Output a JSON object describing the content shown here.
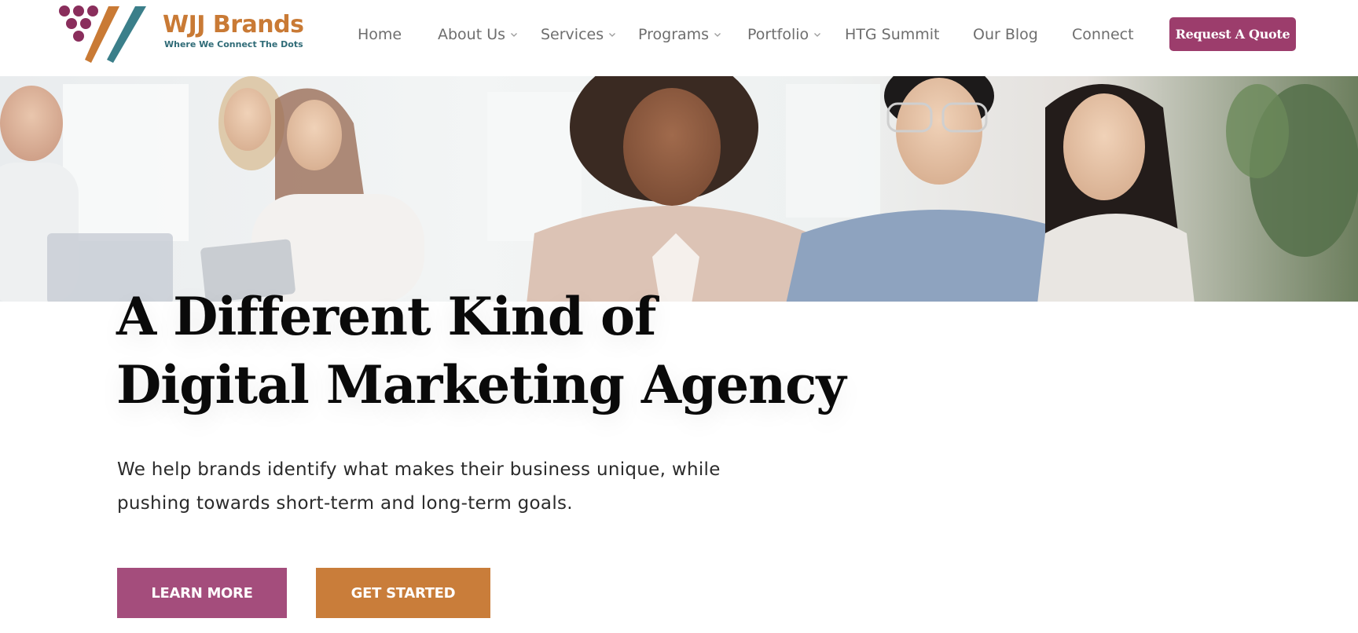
{
  "brand": {
    "name": "WJJ Brands",
    "tagline": "Where We Connect The Dots",
    "colors": {
      "plum": "#8a2e5c",
      "orange": "#c97a35",
      "teal": "#3b7f8a"
    }
  },
  "nav": {
    "items": [
      {
        "label": "Home",
        "has_dropdown": false
      },
      {
        "label": "About Us",
        "has_dropdown": true
      },
      {
        "label": "Services",
        "has_dropdown": true
      },
      {
        "label": "Programs",
        "has_dropdown": true
      },
      {
        "label": "Portfolio",
        "has_dropdown": true
      },
      {
        "label": "HTG Summit",
        "has_dropdown": false
      },
      {
        "label": "Our Blog",
        "has_dropdown": false
      },
      {
        "label": "Connect",
        "has_dropdown": false
      }
    ],
    "cta_label": "Request A Quote",
    "cta_color": "#9c3d6c"
  },
  "hero": {
    "image": "team-collaborating-photo",
    "headline_line1": "A Different Kind of",
    "headline_line2": "Digital Marketing Agency",
    "subtext": "We help brands identify what makes their business unique, while pushing towards short-term and long-term goals.",
    "buttons": {
      "learn_more": "LEARN MORE",
      "get_started": "GET STARTED"
    },
    "button_colors": {
      "learn_more": "#a44d7c",
      "get_started": "#c97d3a"
    }
  }
}
